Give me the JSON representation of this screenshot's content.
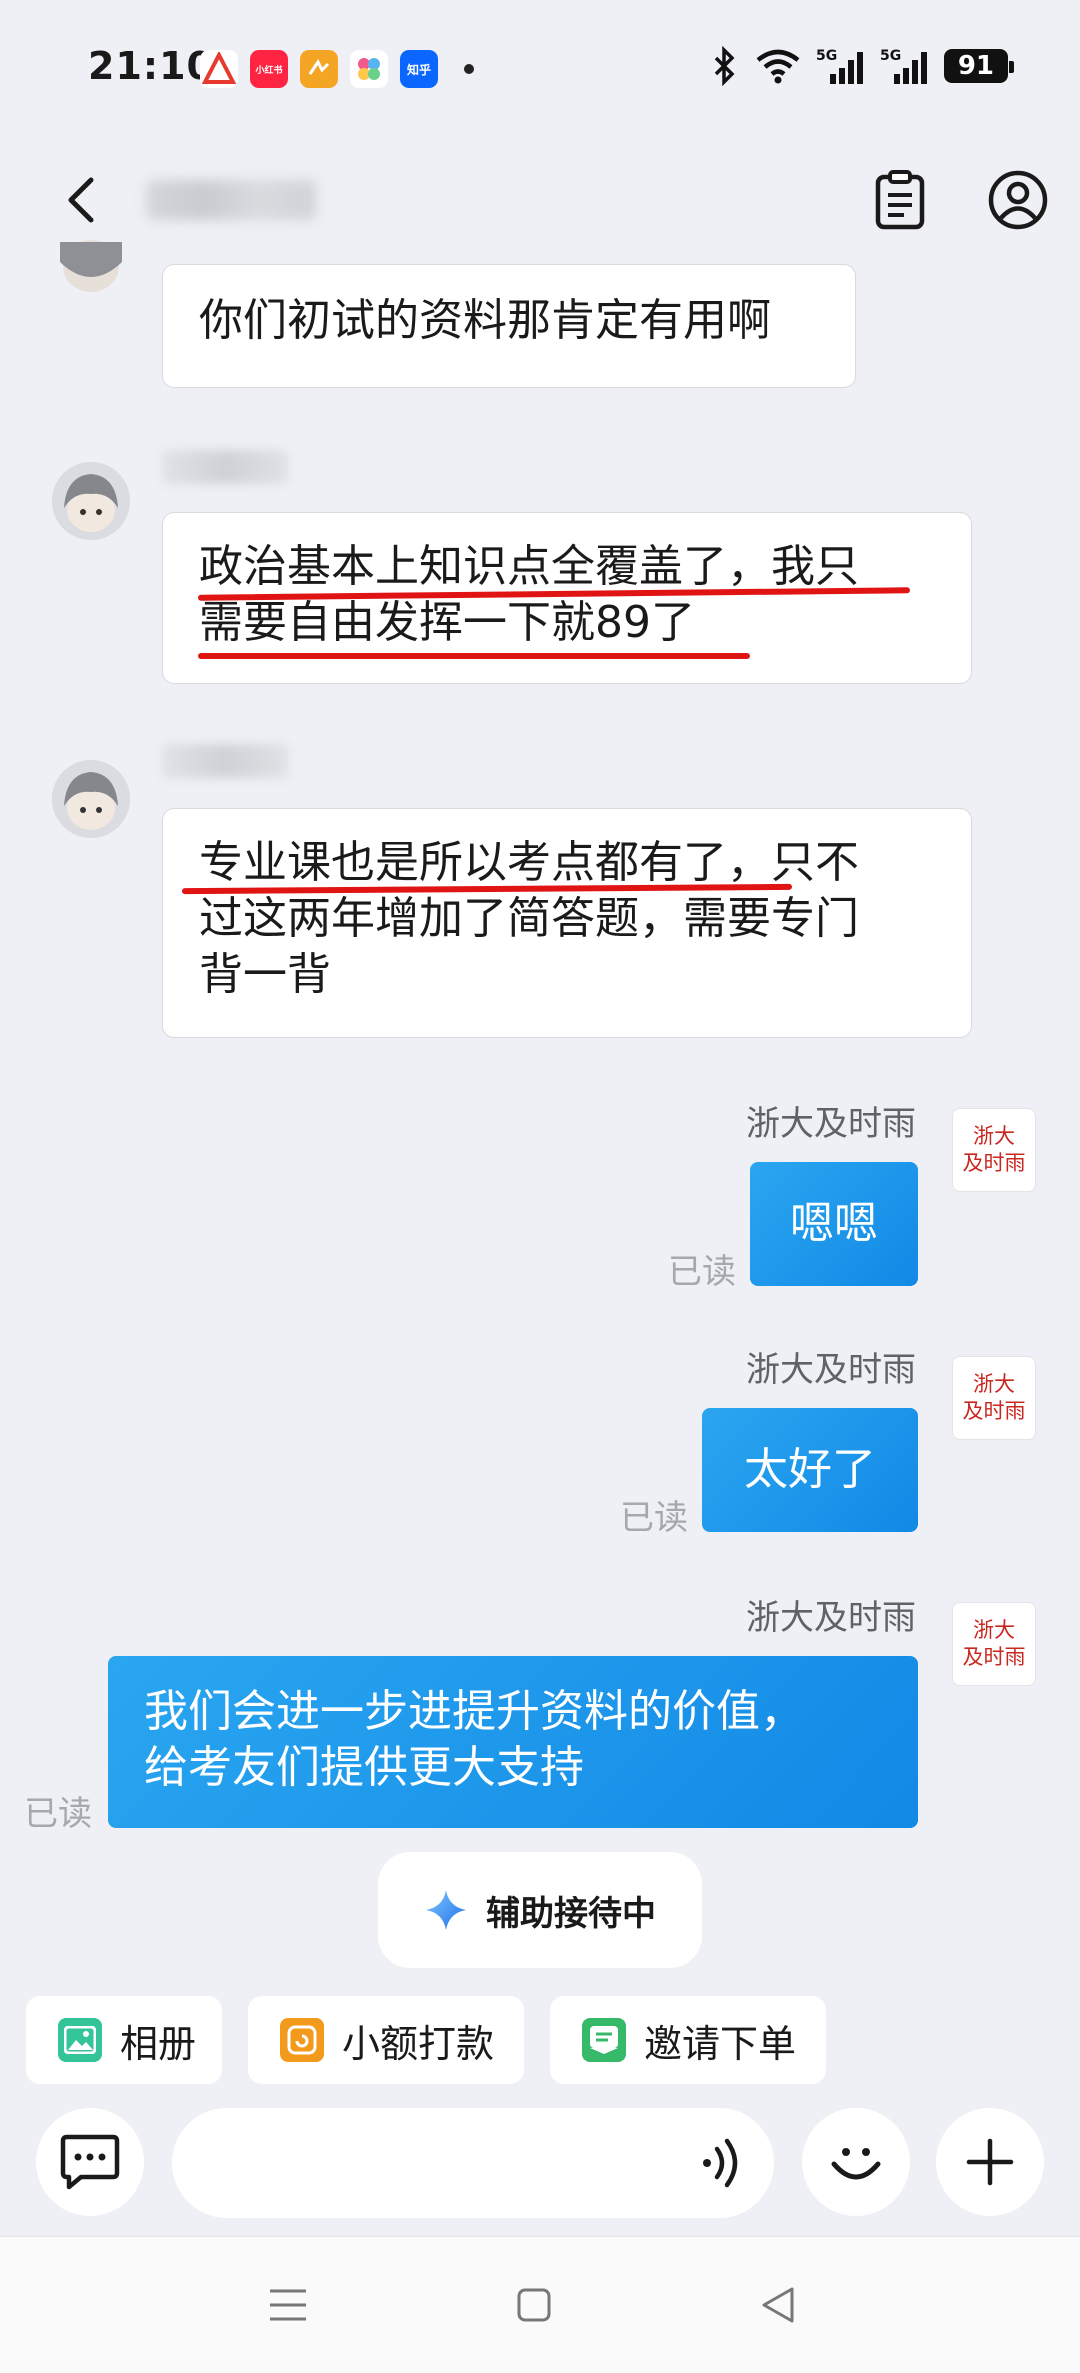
{
  "status_bar": {
    "time": "21:10",
    "battery": "91",
    "notification_apps": [
      "app-icon",
      "小红书",
      "app-icon",
      "app-icon",
      "知乎"
    ]
  },
  "messages": [
    {
      "side": "in",
      "text": "你们初试的资料那肯定有用啊"
    },
    {
      "side": "in",
      "lines": [
        "政治基本上知识点全覆盖了，我只",
        "需要自由发挥一下就89了"
      ]
    },
    {
      "side": "in",
      "lines": [
        "专业课也是所以考点都有了，只不",
        "过这两年增加了简答题，需要专门",
        "背一背"
      ]
    },
    {
      "side": "out",
      "sender": "浙大及时雨",
      "text": "嗯嗯",
      "read": "已读"
    },
    {
      "side": "out",
      "sender": "浙大及时雨",
      "text": "太好了",
      "read": "已读"
    },
    {
      "side": "out",
      "sender": "浙大及时雨",
      "lines": [
        "我们会进一步进提升资料的价值，",
        "给考友们提供更大支持"
      ],
      "read": "已读"
    }
  ],
  "stamp_avatar": {
    "line1": "浙大",
    "line2": "及时雨"
  },
  "assist_status": "辅助接待中",
  "quick_actions": [
    {
      "label": "相册",
      "icon": "image-icon"
    },
    {
      "label": "小额打款",
      "icon": "payment-icon"
    },
    {
      "label": "邀请下单",
      "icon": "order-icon"
    }
  ],
  "colors": {
    "accent": "#1a8fe8",
    "underline": "#e11414",
    "stamp": "#c8281f"
  }
}
